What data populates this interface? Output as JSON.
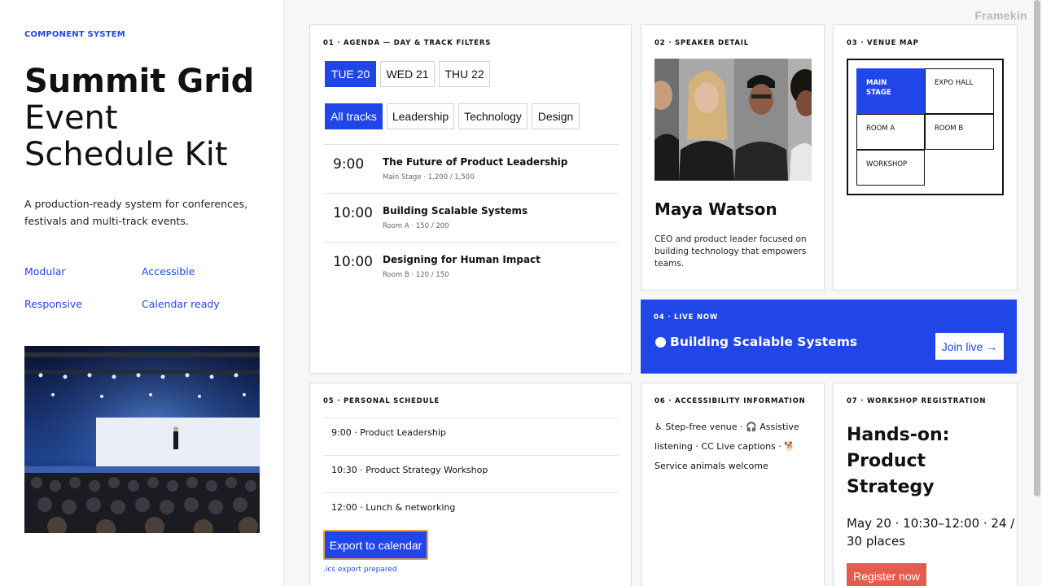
{
  "brand": "Framekin",
  "hero": {
    "eyebrow": "COMPONENT SYSTEM",
    "title_bold": "Summit Grid",
    "title_line2": "Event",
    "title_line3": "Schedule Kit",
    "description": "A production-ready system for conferences, festivals and multi-track events.",
    "features": [
      "Modular",
      "Accessible",
      "Responsive",
      "Calendar ready"
    ]
  },
  "agenda": {
    "label": "01 · AGENDA — DAY & TRACK FILTERS",
    "days": [
      "TUE 20",
      "WED 21",
      "THU 22"
    ],
    "selected_day": "TUE 20",
    "tracks": [
      "All tracks",
      "Leadership",
      "Technology",
      "Design"
    ],
    "selected_track": "All tracks",
    "sessions": [
      {
        "time": "9:00",
        "title": "The Future of Product Leadership",
        "meta": "Main Stage · 1,200 / 1,500"
      },
      {
        "time": "10:00",
        "title": "Building Scalable Systems",
        "meta": "Room A · 150 / 200"
      },
      {
        "time": "10:00",
        "title": "Designing for Human Impact",
        "meta": "Room B · 120 / 150"
      }
    ]
  },
  "speaker": {
    "label": "02 · SPEAKER DETAIL",
    "name": "Maya Watson",
    "bio": "CEO and product leader focused on building technology that empowers teams."
  },
  "venue": {
    "label": "03 · VENUE MAP",
    "rooms": {
      "main_stage": "MAIN STAGE",
      "expo_hall": "EXPO HALL",
      "room_a": "ROOM A",
      "room_b": "ROOM B",
      "workshop": "WORKSHOP"
    },
    "selected_room": "MAIN STAGE"
  },
  "live": {
    "label": "04 · LIVE NOW",
    "title": "Building Scalable Systems",
    "button": "Join live →"
  },
  "personal": {
    "label": "05 · PERSONAL SCHEDULE",
    "items": [
      "9:00 · Product Leadership",
      "10:30 · Product Strategy Workshop",
      "12:00 · Lunch & networking"
    ],
    "export_button": "Export to calendar",
    "export_status": ".ics export prepared"
  },
  "accessibility": {
    "label": "06 · ACCESSIBILITY INFORMATION",
    "text": "♿ Step-free venue · 🎧 Assistive listening · CC Live captions · 🐕 Service animals welcome"
  },
  "workshop": {
    "label": "07 · WORKSHOP REGISTRATION",
    "title": "Hands-on: Product Strategy",
    "meta": "May 20 · 10:30–12:00 · 24 / 30 places",
    "button": "Register now"
  },
  "colors": {
    "accent": "#2146e8",
    "register": "#e55c4c",
    "export_focus": "#e8a040"
  }
}
